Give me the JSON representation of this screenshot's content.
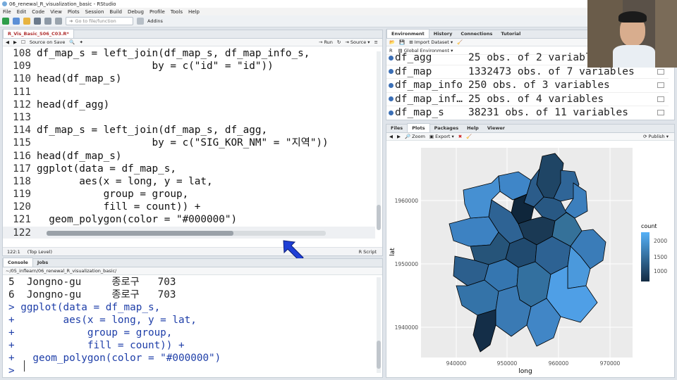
{
  "window": {
    "title": "06_renewal_R_visualization_basic - RStudio"
  },
  "menu": [
    "File",
    "Edit",
    "Code",
    "View",
    "Plots",
    "Session",
    "Build",
    "Debug",
    "Profile",
    "Tools",
    "Help"
  ],
  "toolbar": {
    "goto_placeholder": "Go to file/function",
    "addins": "Addins"
  },
  "editor": {
    "tab_title": "R_Vis_Basic_S06_C03.R*",
    "source_on_save": "Source on Save",
    "run_label": "Run",
    "source_label": "Source",
    "lines": [
      {
        "n": "108",
        "code": "df_map_s = left_join(df_map_s, df_map_info_s,"
      },
      {
        "n": "109",
        "code": "                   by = c(\"id\" = \"id\"))"
      },
      {
        "n": "110",
        "code": "head(df_map_s)"
      },
      {
        "n": "111",
        "code": ""
      },
      {
        "n": "112",
        "code": "head(df_agg)"
      },
      {
        "n": "113",
        "code": ""
      },
      {
        "n": "114",
        "code": "df_map_s = left_join(df_map_s, df_agg,"
      },
      {
        "n": "115",
        "code": "                   by = c(\"SIG_KOR_NM\" = \"지역\"))"
      },
      {
        "n": "116",
        "code": "head(df_map_s)"
      },
      {
        "n": "117",
        "code": "ggplot(data = df_map_s,"
      },
      {
        "n": "118",
        "code": "       aes(x = long, y = lat,"
      },
      {
        "n": "119",
        "code": "           group = group,"
      },
      {
        "n": "120",
        "code": "           fill = count)) +"
      },
      {
        "n": "121",
        "code": "  geom_polygon(color = \"#000000\")"
      },
      {
        "n": "122",
        "code": ""
      }
    ],
    "status_pos": "122:1",
    "status_scope": "(Top Level)",
    "status_lang": "R Script"
  },
  "console": {
    "tabs": [
      "Console",
      "Jobs"
    ],
    "path": "~/05_inflearn/06_renewal_R_visualization_basic/",
    "lines": [
      {
        "text": "5  Jongno-gu     종로구   703",
        "cls": ""
      },
      {
        "text": "6  Jongno-gu     종로구   703",
        "cls": ""
      },
      {
        "text": "> ggplot(data = df_map_s,",
        "cls": "blue"
      },
      {
        "text": "+        aes(x = long, y = lat,",
        "cls": "blue"
      },
      {
        "text": "+            group = group,",
        "cls": "blue"
      },
      {
        "text": "+            fill = count)) +",
        "cls": "blue"
      },
      {
        "text": "+   geom_polygon(color = \"#000000\")",
        "cls": "blue"
      },
      {
        "text": "> ",
        "cls": "blue"
      }
    ]
  },
  "environment": {
    "tabs": [
      "Environment",
      "History",
      "Connections",
      "Tutorial"
    ],
    "import_label": "Import Dataset",
    "scope_label": "Global Environment",
    "lang_label": "R",
    "rows": [
      {
        "name": "df_agg",
        "value": "25 obs. of 2 variables"
      },
      {
        "name": "df_map",
        "value": "1332473 obs. of 7 variables"
      },
      {
        "name": "df_map_info",
        "value": "250 obs. of 3 variables"
      },
      {
        "name": "df_map_inf…",
        "value": "25 obs. of 4 variables"
      },
      {
        "name": "df_map_s",
        "value": "38231 obs. of 11 variables"
      }
    ]
  },
  "plots_pane": {
    "tabs": [
      "Files",
      "Plots",
      "Packages",
      "Help",
      "Viewer"
    ],
    "zoom_label": "Zoom",
    "export_label": "Export",
    "publish_label": "Publish"
  },
  "chart_data": {
    "type": "heatmap",
    "title": "",
    "xlabel": "long",
    "ylabel": "lat",
    "x_ticks": [
      "940000",
      "950000",
      "960000",
      "970000"
    ],
    "y_ticks": [
      "1940000",
      "1950000",
      "1960000"
    ],
    "legend": {
      "title": "count",
      "labels": [
        "2000",
        "1500",
        "1000"
      ],
      "range": [
        700,
        2300
      ],
      "placement": "right"
    },
    "districts_count": 25,
    "colors": {
      "low": "#132b43",
      "high": "#56b1f7",
      "background": "#ebebeb"
    }
  }
}
